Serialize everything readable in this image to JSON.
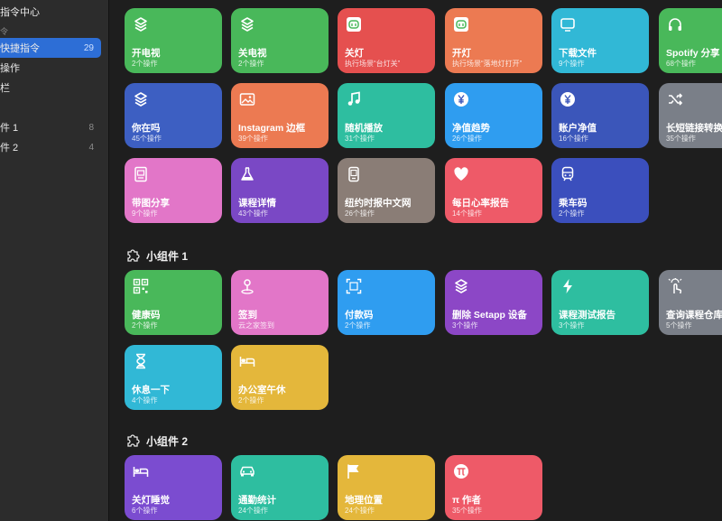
{
  "colors": {
    "sidebar_bg": "#2c2c2c",
    "main_bg": "#1e1e1e",
    "selection": "#2d6ed6"
  },
  "sidebar": {
    "title": "指令中心",
    "section": "令",
    "items": [
      {
        "label": "快捷指令",
        "count": "29",
        "selected": true
      },
      {
        "label": "操作",
        "count": ""
      },
      {
        "label": "栏",
        "count": ""
      },
      {
        "label": "件 1",
        "count": "8"
      },
      {
        "label": "件 2",
        "count": "4"
      }
    ]
  },
  "shortcuts": [
    {
      "name": "开电视",
      "sub": "2个操作",
      "color": "green",
      "icon": "layers-icon"
    },
    {
      "name": "关电视",
      "sub": "2个操作",
      "color": "green",
      "icon": "layers-icon"
    },
    {
      "name": "关灯",
      "sub": "执行场景“台灯关”",
      "color": "red",
      "icon": "mi-home-icon"
    },
    {
      "name": "开灯",
      "sub": "执行场景“落地灯打开”",
      "color": "orange",
      "icon": "mi-home-icon"
    },
    {
      "name": "下载文件",
      "sub": "9个操作",
      "color": "cyan",
      "icon": "tv-icon"
    },
    {
      "name": "Spotify 分享",
      "sub": "68个操作",
      "color": "green",
      "icon": "headphones-icon"
    },
    {
      "name": "你在吗",
      "sub": "45个操作",
      "color": "blue",
      "icon": "layers-icon"
    },
    {
      "name": "Instagram 边框",
      "sub": "39个操作",
      "color": "orange",
      "icon": "photo-icon"
    },
    {
      "name": "随机播放",
      "sub": "31个操作",
      "color": "teal",
      "icon": "music-note-icon"
    },
    {
      "name": "净值趋势",
      "sub": "26个操作",
      "color": "sky",
      "icon": "yen-icon"
    },
    {
      "name": "账户净值",
      "sub": "16个操作",
      "color": "navy",
      "icon": "yen-icon"
    },
    {
      "name": "长短链接转换",
      "sub": "35个操作",
      "color": "grey",
      "icon": "shuffle-icon"
    },
    {
      "name": "带图分享",
      "sub": "9个操作",
      "color": "pink",
      "icon": "photo-frame-icon"
    },
    {
      "name": "课程详情",
      "sub": "43个操作",
      "color": "purple",
      "icon": "flask-icon"
    },
    {
      "name": "纽约时报中文网",
      "sub": "26个操作",
      "color": "brown",
      "icon": "phone-icon"
    },
    {
      "name": "每日心率报告",
      "sub": "14个操作",
      "color": "coral",
      "icon": "heart-icon"
    },
    {
      "name": "乘车码",
      "sub": "2个操作",
      "color": "indigo",
      "icon": "train-icon"
    }
  ],
  "widget1": {
    "title": "小组件 1",
    "items": [
      {
        "name": "健康码",
        "sub": "2个操作",
        "color": "green",
        "icon": "qr-code-icon"
      },
      {
        "name": "签到",
        "sub": "云之家签到",
        "color": "pink",
        "icon": "location-pin-icon"
      },
      {
        "name": "付款码",
        "sub": "2个操作",
        "color": "sky",
        "icon": "scan-code-icon"
      },
      {
        "name": "删除 Setapp 设备",
        "sub": "3个操作",
        "color": "grape",
        "icon": "layers-icon"
      },
      {
        "name": "课程测试报告",
        "sub": "3个操作",
        "color": "teal",
        "icon": "bolt-icon"
      },
      {
        "name": "查询课程仓库",
        "sub": "5个操作",
        "color": "grey",
        "icon": "tap-icon"
      },
      {
        "name": "休息一下",
        "sub": "4个操作",
        "color": "cyan",
        "icon": "hourglass-icon"
      },
      {
        "name": "办公室午休",
        "sub": "2个操作",
        "color": "yellow",
        "icon": "bed-icon"
      }
    ]
  },
  "widget2": {
    "title": "小组件 2",
    "items": [
      {
        "name": "关灯睡觉",
        "sub": "6个操作",
        "color": "lpurple",
        "icon": "bed-icon"
      },
      {
        "name": "通勤统计",
        "sub": "24个操作",
        "color": "teal",
        "icon": "car-icon"
      },
      {
        "name": "地理位置",
        "sub": "24个操作",
        "color": "yellow",
        "icon": "flag-icon"
      },
      {
        "name": "π 作者",
        "sub": "35个操作",
        "color": "coral",
        "icon": "pi-icon"
      }
    ]
  }
}
